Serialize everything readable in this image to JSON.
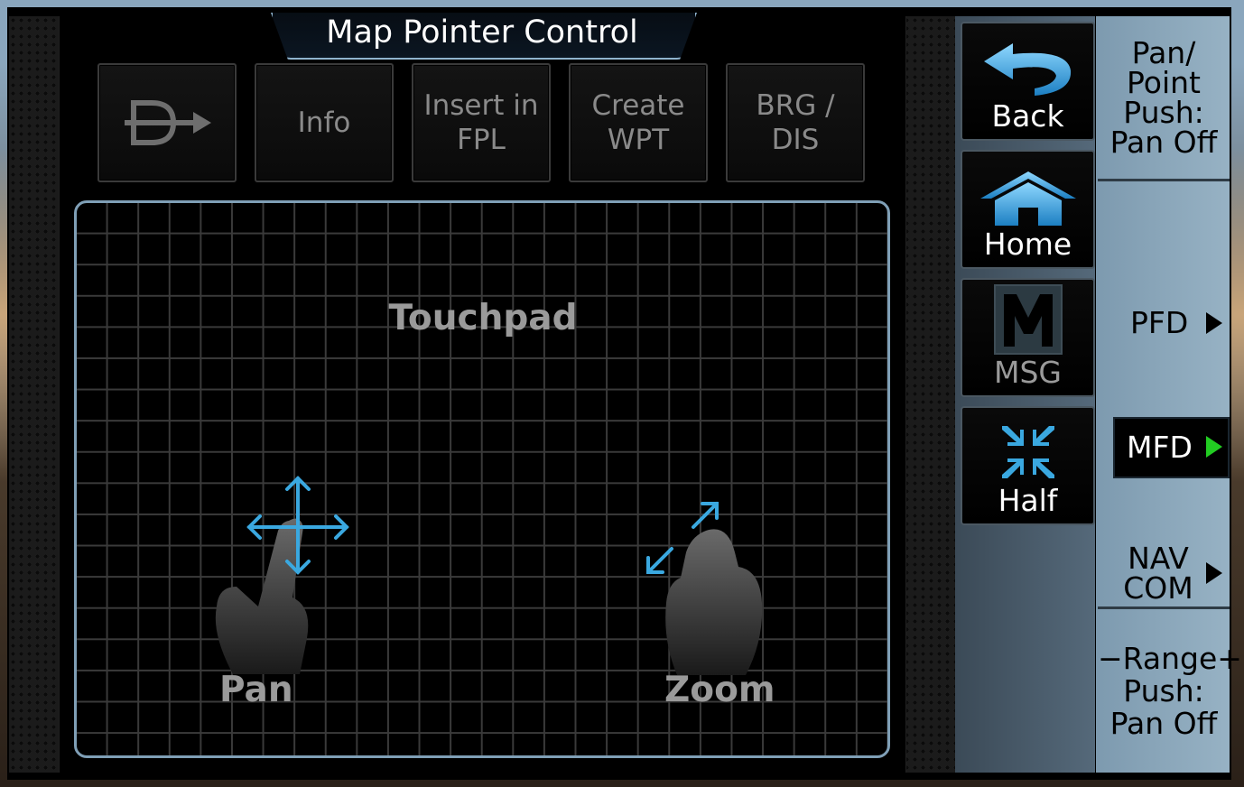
{
  "window": {
    "title": "Map Pointer Control"
  },
  "toolbar": {
    "direct_to_icon": "direct-to-icon",
    "buttons": [
      {
        "label": "Info"
      },
      {
        "label": "Insert in\nFPL"
      },
      {
        "label": "Create\nWPT"
      },
      {
        "label": "BRG /\nDIS"
      }
    ]
  },
  "touchpad": {
    "label": "Touchpad",
    "gestures": [
      {
        "label": "Pan",
        "icon": "pan-gesture-icon"
      },
      {
        "label": "Zoom",
        "icon": "zoom-gesture-icon"
      }
    ]
  },
  "sidebar": {
    "back": {
      "label": "Back",
      "icon": "back-arrow-icon"
    },
    "home": {
      "label": "Home",
      "icon": "home-icon"
    },
    "msg": {
      "label": "MSG",
      "icon": "msg-icon"
    },
    "half": {
      "label": "Half",
      "icon": "half-icon"
    }
  },
  "softkeys": {
    "knob_top": "Pan/\nPoint\nPush:\nPan Off",
    "pfd": "PFD",
    "mfd": "MFD",
    "nav_com": "NAV\nCOM",
    "knob_bottom": "−Range+\nPush:\nPan Off"
  },
  "colors": {
    "accent_blue": "#3aa8e0",
    "frame_blue": "#7f9fb6",
    "active_green": "#22cc22"
  }
}
